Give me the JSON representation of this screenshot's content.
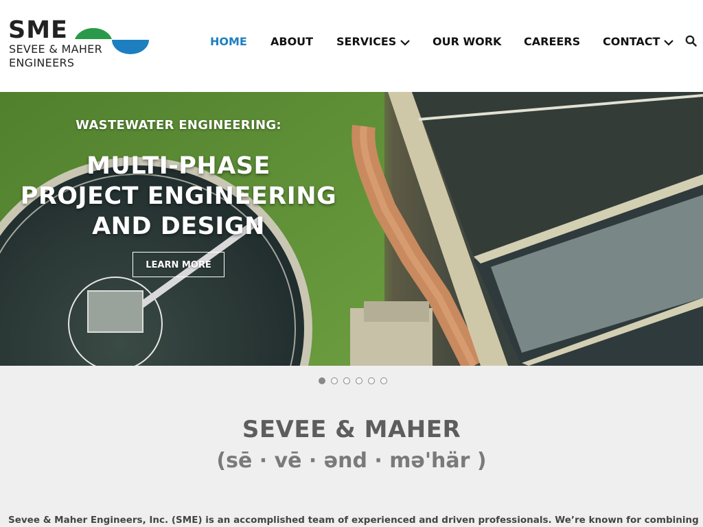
{
  "logo": {
    "abbr": "SME",
    "line1": "SEVEE & MAHER",
    "line2": "ENGINEERS",
    "colors": {
      "green": "#2a9a4a",
      "blue": "#1d7fc0"
    }
  },
  "nav": {
    "items": [
      {
        "label": "HOME",
        "active": true
      },
      {
        "label": "ABOUT"
      },
      {
        "label": "SERVICES",
        "dropdown": true
      },
      {
        "label": "OUR WORK"
      },
      {
        "label": "CAREERS"
      },
      {
        "label": "CONTACT",
        "dropdown": true
      }
    ],
    "search_icon": "search-icon",
    "active_color": "#1d7fc0"
  },
  "hero": {
    "eyebrow": "WASTEWATER ENGINEERING:",
    "title_line1": "MULTI-PHASE",
    "title_line2": "PROJECT ENGINEERING",
    "title_line3": "AND DESIGN",
    "button": "LEARN MORE"
  },
  "slider": {
    "count": 6,
    "active_index": 0
  },
  "intro": {
    "title": "SEVEE & MAHER",
    "pronunciation": "(sē · vē · ənd · mə'här )",
    "text": "Sevee & Maher Engineers, Inc. (SME) is an accomplished team of experienced and driven professionals. We’re known for combining strong"
  }
}
